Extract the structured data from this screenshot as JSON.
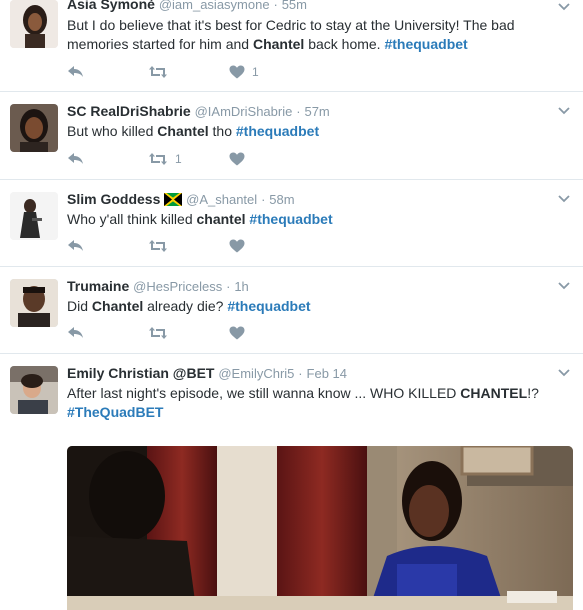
{
  "tweets": [
    {
      "name": "Asia Symonè",
      "handle": "@iam_asiasymone",
      "sep": "·",
      "time": "55m",
      "text1": "But I do believe that it's best for Cedric to stay at the University! The bad memories started for him and ",
      "bold1": "Chantel",
      "text2": " back home. ",
      "tag": "#thequadbet",
      "retweets": "",
      "likes": "1"
    },
    {
      "name": "SC RealDriShabrie",
      "handle": "@IAmDriShabrie",
      "sep": "·",
      "time": "57m",
      "text1": "But who killed ",
      "bold1": "Chantel",
      "text2": " tho ",
      "tag": "#thequadbet",
      "retweets": "1",
      "likes": ""
    },
    {
      "name": "Slim Goddess",
      "handle": "@A_shantel",
      "sep": "·",
      "time": "58m",
      "text1": "Who y'all think killed ",
      "bold1": "chantel",
      "text2": " ",
      "tag": "#thequadbet",
      "retweets": "",
      "likes": ""
    },
    {
      "name": "Trumaine",
      "handle": "@HesPriceless",
      "sep": "·",
      "time": "1h",
      "text1": "Did ",
      "bold1": "Chantel",
      "text2": " already die?  ",
      "tag": "#thequadbet",
      "retweets": "",
      "likes": ""
    },
    {
      "name": "Emily Christian @BET",
      "handle": "@EmilyChri5",
      "sep": "·",
      "time": "Feb 14",
      "text1": "After last night's episode, we still wanna know ... WHO KILLED ",
      "bold1": "CHANTEL",
      "text2": "!? ",
      "tag": "#TheQuadBET",
      "retweets": "",
      "likes": ""
    }
  ],
  "icons": {
    "reply": "reply-icon",
    "retweet": "retweet-icon",
    "like": "heart-icon",
    "more": "chevron-down-icon",
    "flag": "jamaica-flag-icon"
  },
  "colors": {
    "hashtag": "#2b7bb9",
    "muted": "#8899a6",
    "text": "#292f33",
    "divider": "#e1e8ed"
  }
}
